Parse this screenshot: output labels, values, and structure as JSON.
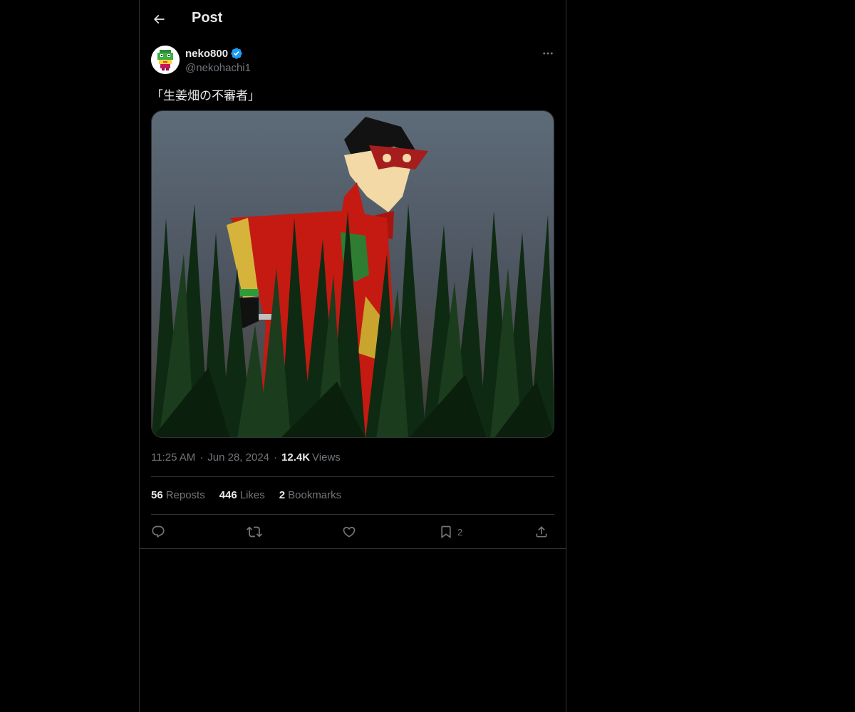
{
  "header": {
    "title": "Post",
    "back_icon": "arrow-left-icon"
  },
  "author": {
    "display_name": "neko800",
    "handle": "@nekohachi1",
    "verified": true,
    "verified_color": "#1d9bf0",
    "more_icon": "more-horizontal-icon"
  },
  "tweet": {
    "text": "「生姜畑の不審者」",
    "time": "11:25 AM",
    "date": "Jun 28, 2024",
    "views_count": "12.4K",
    "views_label": "Views",
    "separator": "·"
  },
  "stats": {
    "reposts_count": "56",
    "reposts_label": "Reposts",
    "likes_count": "446",
    "likes_label": "Likes",
    "bookmarks_count": "2",
    "bookmarks_label": "Bookmarks"
  },
  "actions": {
    "reply_icon": "reply-icon",
    "repost_icon": "repost-icon",
    "like_icon": "heart-icon",
    "bookmark_icon": "bookmark-icon",
    "bookmark_count": "2",
    "share_icon": "share-icon"
  },
  "colors": {
    "background": "#000000",
    "text_primary": "#e7e9ea",
    "text_secondary": "#71767b",
    "border": "#2f3336"
  }
}
